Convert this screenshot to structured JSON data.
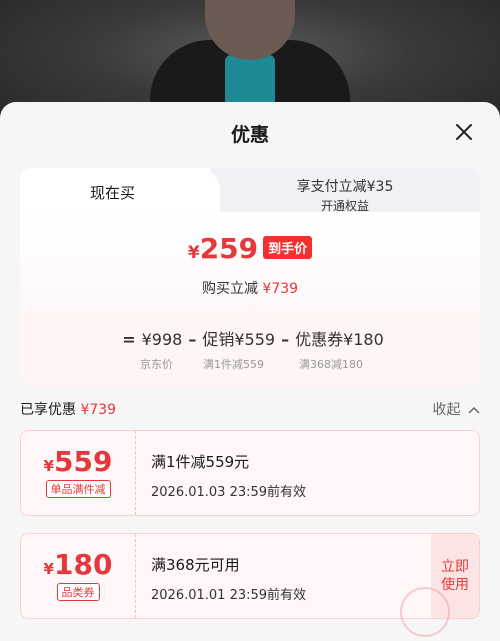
{
  "sheet": {
    "title": "优惠"
  },
  "tabs": {
    "current": "现在买",
    "pay_line1": "享支付立减¥35",
    "pay_line2": "开通权益"
  },
  "summary": {
    "yen": "¥",
    "price": "259",
    "price_tag": "到手价",
    "reduce_label": "购买立减",
    "reduce_value": "¥739"
  },
  "formula": {
    "eq": "=",
    "jd_price": "¥998",
    "minus1": "–",
    "promo": "促销¥559",
    "minus2": "–",
    "coupon": "优惠券¥180",
    "jd_label": "京东价",
    "promo_label": "满1件减559",
    "coupon_label": "满368减180"
  },
  "enjoyed": {
    "label": "已享优惠",
    "value": "¥739",
    "collapse": "收起"
  },
  "coupons": [
    {
      "yen": "¥",
      "amount": "559",
      "badge": "单品满件减",
      "desc": "满1件减559元",
      "date": "2026.01.03 23:59前有效"
    },
    {
      "yen": "¥",
      "amount": "180",
      "badge": "品类券",
      "desc": "满368元可用",
      "date": "2026.01.01 23:59前有效",
      "use_l1": "立即",
      "use_l2": "使用"
    }
  ],
  "colors": {
    "accent": "#e4393c",
    "sheet_bg": "#f6f6f6"
  }
}
